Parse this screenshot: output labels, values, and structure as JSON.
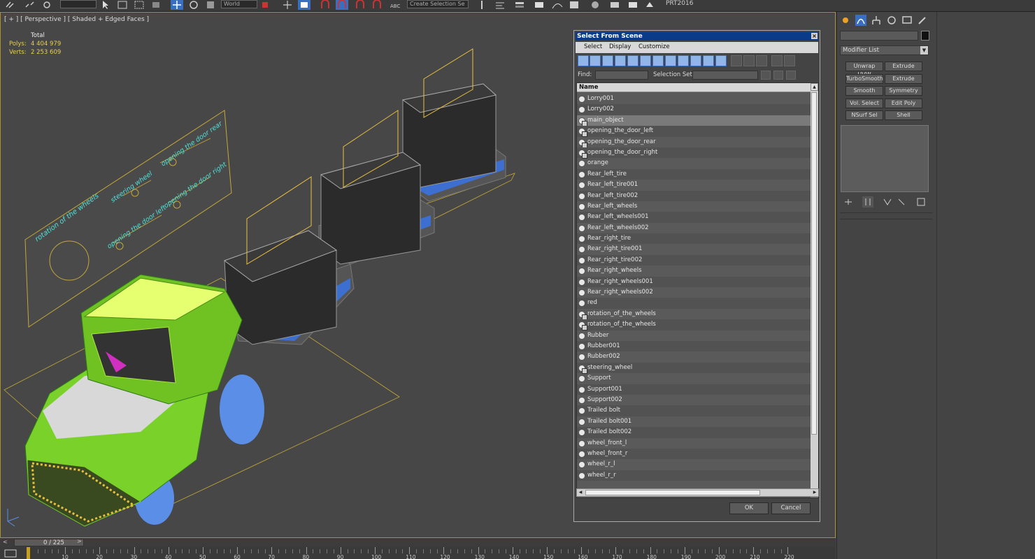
{
  "toolbar": {
    "coord_dropdown": "World",
    "selection_set_dropdown": "Create Selection Se",
    "project_label": "PRT2016"
  },
  "viewport": {
    "label": "[ + ] [ Perspective ] [ Shaded + Edged Faces ]",
    "stats": {
      "header": "Total",
      "polys_label": "Polys:",
      "polys_value": "4 404 979",
      "verts_label": "Verts:",
      "verts_value": "2 253 609"
    },
    "scene_texts": {
      "rotation_of_the_wheels": "rotation of the wheels",
      "steering_wheel": "steering wheel",
      "opening_door_rear": "opening the door rear",
      "opening_door_left": "opening the door left",
      "opening_door_right": "opening the door right"
    }
  },
  "dialog": {
    "title": "Select From Scene",
    "close": "×",
    "menu": [
      "Select",
      "Display",
      "Customize"
    ],
    "find_label": "Find:",
    "selection_set_label": "Selection Set:",
    "column_name": "Name",
    "ok": "OK",
    "cancel": "Cancel",
    "items": [
      {
        "name": "Lorry001",
        "group": false,
        "selected": false
      },
      {
        "name": "Lorry002",
        "group": false,
        "selected": false
      },
      {
        "name": "main_object",
        "group": true,
        "selected": true
      },
      {
        "name": "opening_the_door_left",
        "group": true,
        "selected": false
      },
      {
        "name": "opening_the_door_rear",
        "group": true,
        "selected": false
      },
      {
        "name": "opening_the_door_right",
        "group": true,
        "selected": false
      },
      {
        "name": "orange",
        "group": false,
        "selected": false
      },
      {
        "name": "Rear_left_tire",
        "group": false,
        "selected": false
      },
      {
        "name": "Rear_left_tire001",
        "group": false,
        "selected": false
      },
      {
        "name": "Rear_left_tire002",
        "group": false,
        "selected": false
      },
      {
        "name": "Rear_left_wheels",
        "group": false,
        "selected": false
      },
      {
        "name": "Rear_left_wheels001",
        "group": false,
        "selected": false
      },
      {
        "name": "Rear_left_wheels002",
        "group": false,
        "selected": false
      },
      {
        "name": "Rear_right_tire",
        "group": false,
        "selected": false
      },
      {
        "name": "Rear_right_tire001",
        "group": false,
        "selected": false
      },
      {
        "name": "Rear_right_tire002",
        "group": false,
        "selected": false
      },
      {
        "name": "Rear_right_wheels",
        "group": false,
        "selected": false
      },
      {
        "name": "Rear_right_wheels001",
        "group": false,
        "selected": false
      },
      {
        "name": "Rear_right_wheels002",
        "group": false,
        "selected": false
      },
      {
        "name": "red",
        "group": false,
        "selected": false
      },
      {
        "name": "rotation_of_the_wheels",
        "group": true,
        "selected": false
      },
      {
        "name": "rotation_of_the_wheels",
        "group": true,
        "selected": false
      },
      {
        "name": "Rubber",
        "group": false,
        "selected": false
      },
      {
        "name": "Rubber001",
        "group": false,
        "selected": false
      },
      {
        "name": "Rubber002",
        "group": false,
        "selected": false
      },
      {
        "name": "steering_wheel",
        "group": true,
        "selected": false
      },
      {
        "name": "Support",
        "group": false,
        "selected": false
      },
      {
        "name": "Support001",
        "group": false,
        "selected": false
      },
      {
        "name": "Support002",
        "group": false,
        "selected": false
      },
      {
        "name": "Trailed bolt",
        "group": false,
        "selected": false
      },
      {
        "name": "Trailed bolt001",
        "group": false,
        "selected": false
      },
      {
        "name": "Trailed bolt002",
        "group": false,
        "selected": false
      },
      {
        "name": "wheel_front_l",
        "group": false,
        "selected": false
      },
      {
        "name": "wheel_front_r",
        "group": false,
        "selected": false
      },
      {
        "name": "wheel_r_l",
        "group": false,
        "selected": false
      },
      {
        "name": "wheel_r_r",
        "group": false,
        "selected": false
      }
    ]
  },
  "command_panel": {
    "modifier_list": "Modifier List",
    "modifier_buttons": [
      "Unwrap UVW",
      "Extrude",
      "TurboSmooth",
      "Extrude",
      "Smooth",
      "Symmetry",
      "Vol. Select",
      "Edit Poly",
      "NSurf Sel",
      "Shell"
    ]
  },
  "timeline": {
    "position": "0 / 225",
    "prev": "<",
    "next": ">",
    "ticks": [
      "10",
      "20",
      "30",
      "40",
      "50",
      "60",
      "70",
      "80",
      "90",
      "100",
      "110",
      "120",
      "130",
      "140",
      "150",
      "160",
      "170",
      "180",
      "190",
      "200",
      "210",
      "220"
    ]
  },
  "colors": {
    "accent_title": "#0a3b88",
    "stats_yellow": "#e8d050",
    "truck_green": "#7ad12a",
    "wheel_blue": "#5b8ee6",
    "text_yellow": "#f0d040",
    "text_cyan": "#4fe0d8"
  }
}
